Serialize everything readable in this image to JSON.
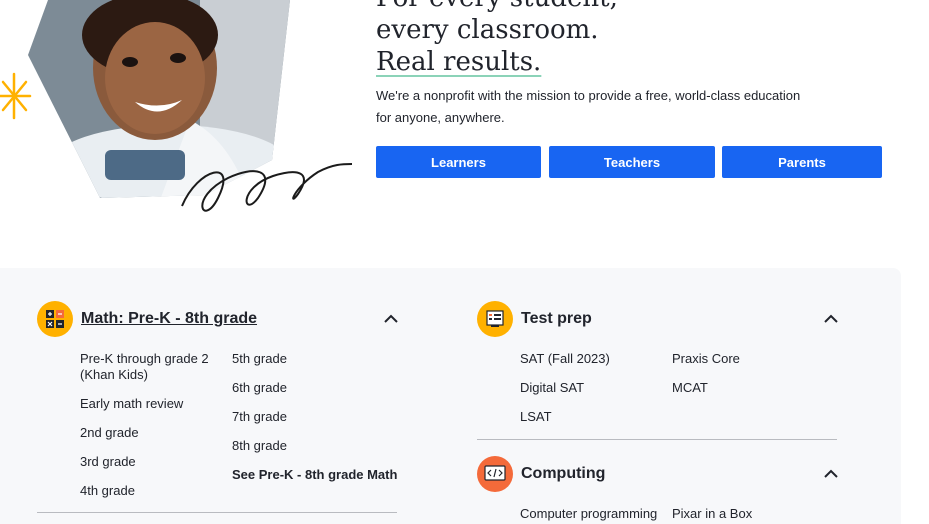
{
  "hero": {
    "headline_line1": "For every student,",
    "headline_line2": "every classroom.",
    "headline_line3": "Real results.",
    "mission": "We're a nonprofit with the mission to provide a free, world-class education for anyone, anywhere.",
    "buttons": {
      "learners": "Learners",
      "teachers": "Teachers",
      "parents": "Parents"
    }
  },
  "colors": {
    "primary_blue": "#1865f2",
    "panel_bg": "#f7f8fa",
    "icon_yellow": "#ffb100",
    "icon_orange": "#f46a3a"
  },
  "categories": {
    "math": {
      "title": "Math: Pre-K - 8th grade",
      "icon": "math-calculator-icon",
      "items_col1": [
        "Pre-K through grade 2",
        "(Khan Kids)",
        "Early math review",
        "2nd grade",
        "3rd grade",
        "4th grade"
      ],
      "items_col2": [
        "5th grade",
        "6th grade",
        "7th grade",
        "8th grade",
        "See Pre-K - 8th grade Math"
      ]
    },
    "test_prep": {
      "title": "Test prep",
      "icon": "test-prep-icon",
      "items_col1": [
        "SAT (Fall 2023)",
        "Digital SAT",
        "LSAT"
      ],
      "items_col2": [
        "Praxis Core",
        "MCAT"
      ]
    },
    "computing": {
      "title": "Computing",
      "icon": "code-icon",
      "items_col1": [
        "Computer programming"
      ],
      "items_col2": [
        "Pixar in a Box"
      ]
    }
  }
}
